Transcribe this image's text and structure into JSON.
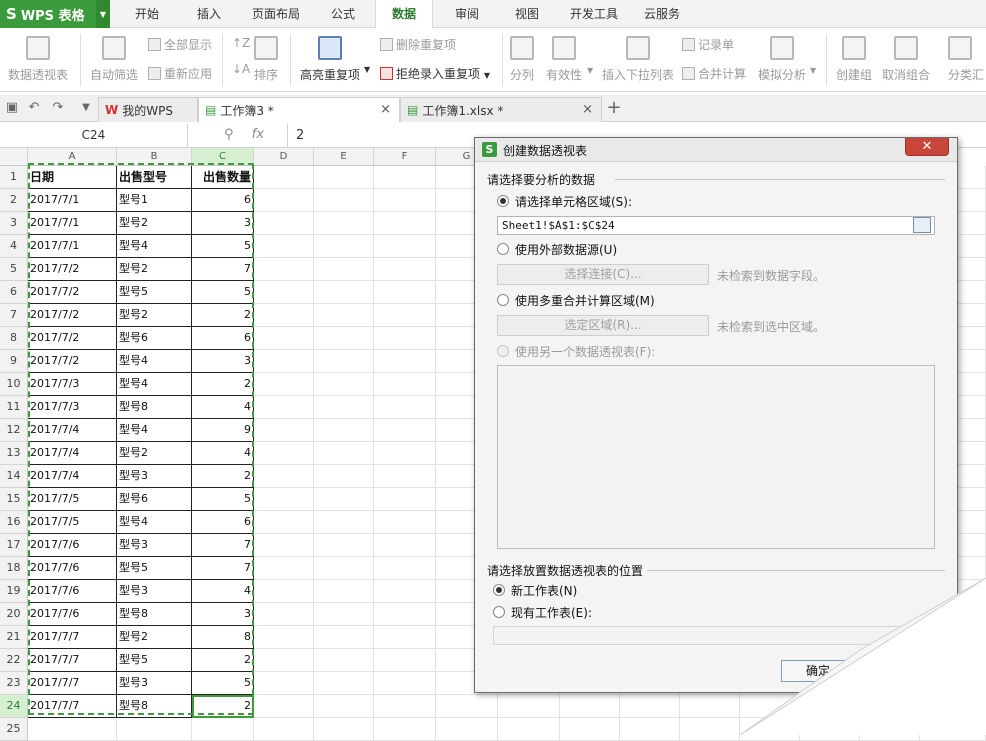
{
  "app": {
    "name": "WPS 表格"
  },
  "menu_tabs": [
    "开始",
    "插入",
    "页面布局",
    "公式",
    "数据",
    "审阅",
    "视图",
    "开发工具",
    "云服务"
  ],
  "ribbon": {
    "pivot": "数据透视表",
    "auto_filter": "自动筛选",
    "show_all": "全部显示",
    "reapply": "重新应用",
    "sort": "排序",
    "highlight_dup": "高亮重复项",
    "remove_dup": "删除重复项",
    "reject_dup": "拒绝录入重复项",
    "split": "分列",
    "validity": "有效性",
    "dropdown_list": "插入下拉列表",
    "record": "记录单",
    "consolidate": "合并计算",
    "simulate": "模拟分析",
    "group": "创建组",
    "ungroup": "取消组合",
    "subtotal": "分类汇"
  },
  "doc_tabs": [
    "我的WPS",
    "工作簿3 *",
    "工作簿1.xlsx *"
  ],
  "formula_bar": {
    "name_box": "C24",
    "fx": "fx",
    "value": "2"
  },
  "columns": [
    "A",
    "B",
    "C",
    "D",
    "E",
    "F",
    "G"
  ],
  "sheet": {
    "headers": [
      "日期",
      "出售型号",
      "出售数量"
    ],
    "rows": [
      [
        "2017/7/1",
        "型号1",
        "6"
      ],
      [
        "2017/7/1",
        "型号2",
        "3"
      ],
      [
        "2017/7/1",
        "型号4",
        "5"
      ],
      [
        "2017/7/2",
        "型号2",
        "7"
      ],
      [
        "2017/7/2",
        "型号5",
        "5"
      ],
      [
        "2017/7/2",
        "型号2",
        "2"
      ],
      [
        "2017/7/2",
        "型号6",
        "6"
      ],
      [
        "2017/7/2",
        "型号4",
        "3"
      ],
      [
        "2017/7/3",
        "型号4",
        "2"
      ],
      [
        "2017/7/3",
        "型号8",
        "4"
      ],
      [
        "2017/7/4",
        "型号4",
        "9"
      ],
      [
        "2017/7/4",
        "型号2",
        "4"
      ],
      [
        "2017/7/4",
        "型号3",
        "2"
      ],
      [
        "2017/7/5",
        "型号6",
        "5"
      ],
      [
        "2017/7/5",
        "型号4",
        "6"
      ],
      [
        "2017/7/6",
        "型号3",
        "7"
      ],
      [
        "2017/7/6",
        "型号5",
        "7"
      ],
      [
        "2017/7/6",
        "型号3",
        "4"
      ],
      [
        "2017/7/6",
        "型号8",
        "3"
      ],
      [
        "2017/7/7",
        "型号2",
        "8"
      ],
      [
        "2017/7/7",
        "型号5",
        "2"
      ],
      [
        "2017/7/7",
        "型号3",
        "5"
      ],
      [
        "2017/7/7",
        "型号8",
        "2"
      ]
    ],
    "row_numbers": [
      "1",
      "2",
      "3",
      "4",
      "5",
      "6",
      "7",
      "8",
      "9",
      "10",
      "11",
      "12",
      "13",
      "14",
      "15",
      "16",
      "17",
      "18",
      "19",
      "20",
      "21",
      "22",
      "23",
      "24",
      "25"
    ]
  },
  "dialog": {
    "title": "创建数据透视表",
    "section1": "请选择要分析的数据",
    "opt_range": "请选择单元格区域(S):",
    "range_value": "Sheet1!$A$1:$C$24",
    "opt_external": "使用外部数据源(U)",
    "select_conn": "选择连接(C)...",
    "no_fields": "未检索到数据字段。",
    "opt_multi": "使用多重合并计算区域(M)",
    "select_area": "选定区域(R)...",
    "no_area": "未检索到选中区域。",
    "opt_other_pivot": "使用另一个数据透视表(F):",
    "section2": "请选择放置数据透视表的位置",
    "opt_new_sheet": "新工作表(N)",
    "opt_existing": "现有工作表(E):",
    "ok": "确定"
  },
  "colors": {
    "accent": "#3b9a3b",
    "close": "#c9463a"
  }
}
